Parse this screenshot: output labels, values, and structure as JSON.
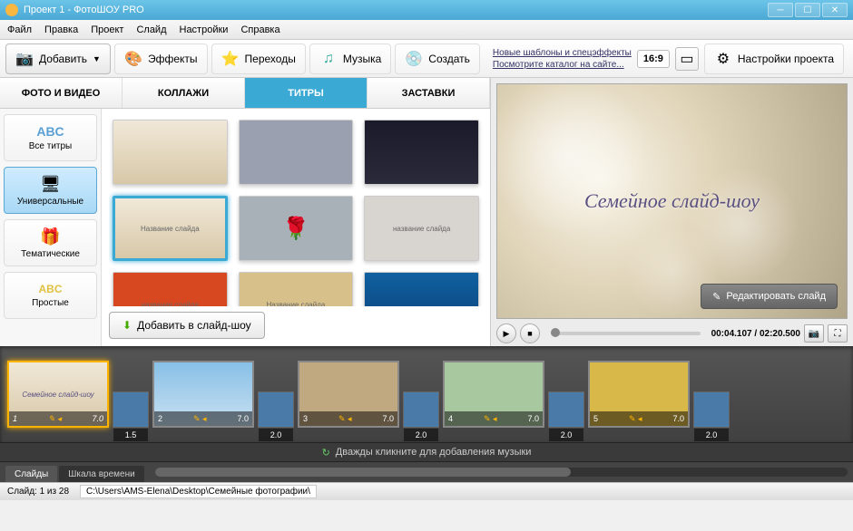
{
  "window": {
    "title": "Проект 1 - ФотоШОУ PRO"
  },
  "menu": [
    "Файл",
    "Правка",
    "Проект",
    "Слайд",
    "Настройки",
    "Справка"
  ],
  "toolbar": {
    "add": "Добавить",
    "effects": "Эффекты",
    "transitions": "Переходы",
    "music": "Музыка",
    "create": "Создать",
    "link1": "Новые шаблоны и спецэффекты",
    "link2": "Посмотрите каталог на сайте...",
    "ratio": "16:9",
    "settings": "Настройки проекта"
  },
  "tabs": [
    "ФОТО И ВИДЕО",
    "КОЛЛАЖИ",
    "ТИТРЫ",
    "ЗАСТАВКИ"
  ],
  "tabs_active": 2,
  "sidebar": [
    {
      "label": "Все титры",
      "icon": "ABC",
      "color": "#5a9fd4"
    },
    {
      "label": "Универсальные",
      "icon": "🖥",
      "color": "#f0a020"
    },
    {
      "label": "Тематические",
      "icon": "🎁",
      "color": "#55bdd8"
    },
    {
      "label": "Простые",
      "icon": "ABC",
      "color": "#e0c040"
    }
  ],
  "sidebar_active": 1,
  "gallery_add": "Добавить в слайд-шоу",
  "thumbs": [
    {
      "bg": "linear-gradient(#f0e8d8,#d8c8a8)",
      "txt": ""
    },
    {
      "bg": "#9aa0b0",
      "txt": ""
    },
    {
      "bg": "linear-gradient(#1a1a2a,#2a2a3a)",
      "txt": ""
    },
    {
      "bg": "linear-gradient(#f0e8d8,#d8c8a8)",
      "txt": "Название слайда",
      "sel": true
    },
    {
      "bg": "#a8b0b8",
      "txt": "🌹"
    },
    {
      "bg": "#d8d4d0",
      "txt": "название слайда"
    },
    {
      "bg": "#d84820",
      "txt": "название слайда"
    },
    {
      "bg": "#d8c08a",
      "txt": "Название слайда"
    },
    {
      "bg": "linear-gradient(#1060a0,#0a4078)",
      "txt": ""
    }
  ],
  "preview": {
    "title": "Семейное слайд-шоу",
    "edit": "Редактировать слайд"
  },
  "player": {
    "current": "00:04.107",
    "total": "02:20.500"
  },
  "timeline": {
    "slides": [
      {
        "num": "1",
        "dur": "7.0",
        "tdur": "1.5",
        "bg": "linear-gradient(#f0e8d8,#d8c8a8)",
        "txt": "Семейное слайд-шоу",
        "sel": true
      },
      {
        "num": "2",
        "dur": "7.0",
        "tdur": "2.0",
        "bg": "linear-gradient(#88c0e8,#c8e0f0)",
        "txt": ""
      },
      {
        "num": "3",
        "dur": "7.0",
        "tdur": "2.0",
        "bg": "#c0a880",
        "txt": ""
      },
      {
        "num": "4",
        "dur": "7.0",
        "tdur": "2.0",
        "bg": "#a8c8a0",
        "txt": ""
      },
      {
        "num": "5",
        "dur": "7.0",
        "tdur": "2.0",
        "bg": "#d8b848",
        "txt": ""
      }
    ],
    "music_hint": "Дважды кликните для добавления музыки",
    "view_tabs": [
      "Слайды",
      "Шкала времени"
    ],
    "view_active": 0
  },
  "status": {
    "slide": "Слайд: 1 из 28",
    "path": "C:\\Users\\AMS-Elena\\Desktop\\Семейные фотографии\\"
  }
}
